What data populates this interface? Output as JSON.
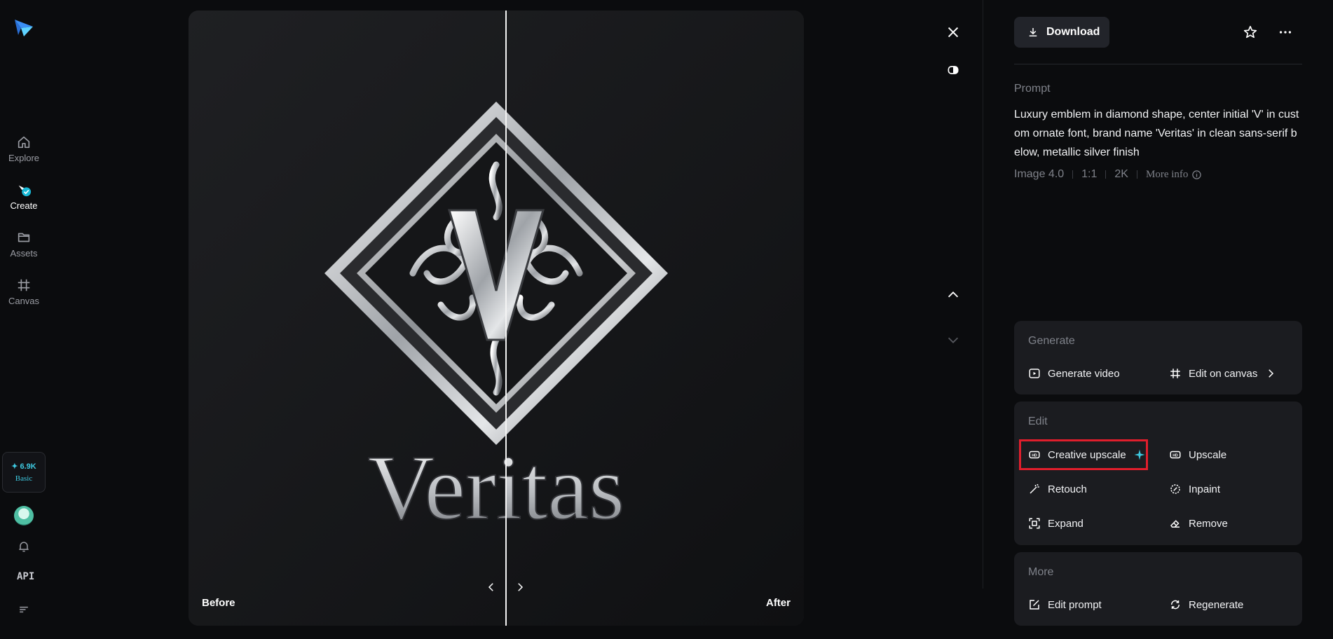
{
  "sidebar": {
    "logo_icon": "paper-plane-logo",
    "items": [
      {
        "label": "Explore",
        "icon": "home-icon"
      },
      {
        "label": "Create",
        "icon": "create-icon"
      },
      {
        "label": "Assets",
        "icon": "folder-icon"
      },
      {
        "label": "Canvas",
        "icon": "canvas-icon"
      }
    ],
    "credits": {
      "amount": "✦ 6.9K",
      "plan": "Basic"
    },
    "api_label": "API"
  },
  "viewer": {
    "before_label": "Before",
    "after_label": "After",
    "image_text": "Veritas"
  },
  "panel": {
    "download_label": "Download",
    "prompt_heading": "Prompt",
    "prompt_text": "Luxury emblem in diamond shape, center initial 'V' in custom ornate font, brand name 'Veritas' in clean sans-serif below, metallic silver finish",
    "meta": {
      "model": "Image 4.0",
      "ratio": "1:1",
      "resolution": "2K",
      "more_info": "More info"
    },
    "generate": {
      "title": "Generate",
      "generate_video": "Generate video",
      "edit_on_canvas": "Edit on canvas"
    },
    "edit": {
      "title": "Edit",
      "creative_upscale": "Creative upscale",
      "upscale": "Upscale",
      "retouch": "Retouch",
      "inpaint": "Inpaint",
      "expand": "Expand",
      "remove": "Remove"
    },
    "more": {
      "title": "More",
      "edit_prompt": "Edit prompt",
      "regenerate": "Regenerate"
    }
  },
  "colors": {
    "accent": "#3ec9e0",
    "highlight": "#e01e2c",
    "background": "#0b0c0e",
    "card": "#1b1c20"
  }
}
